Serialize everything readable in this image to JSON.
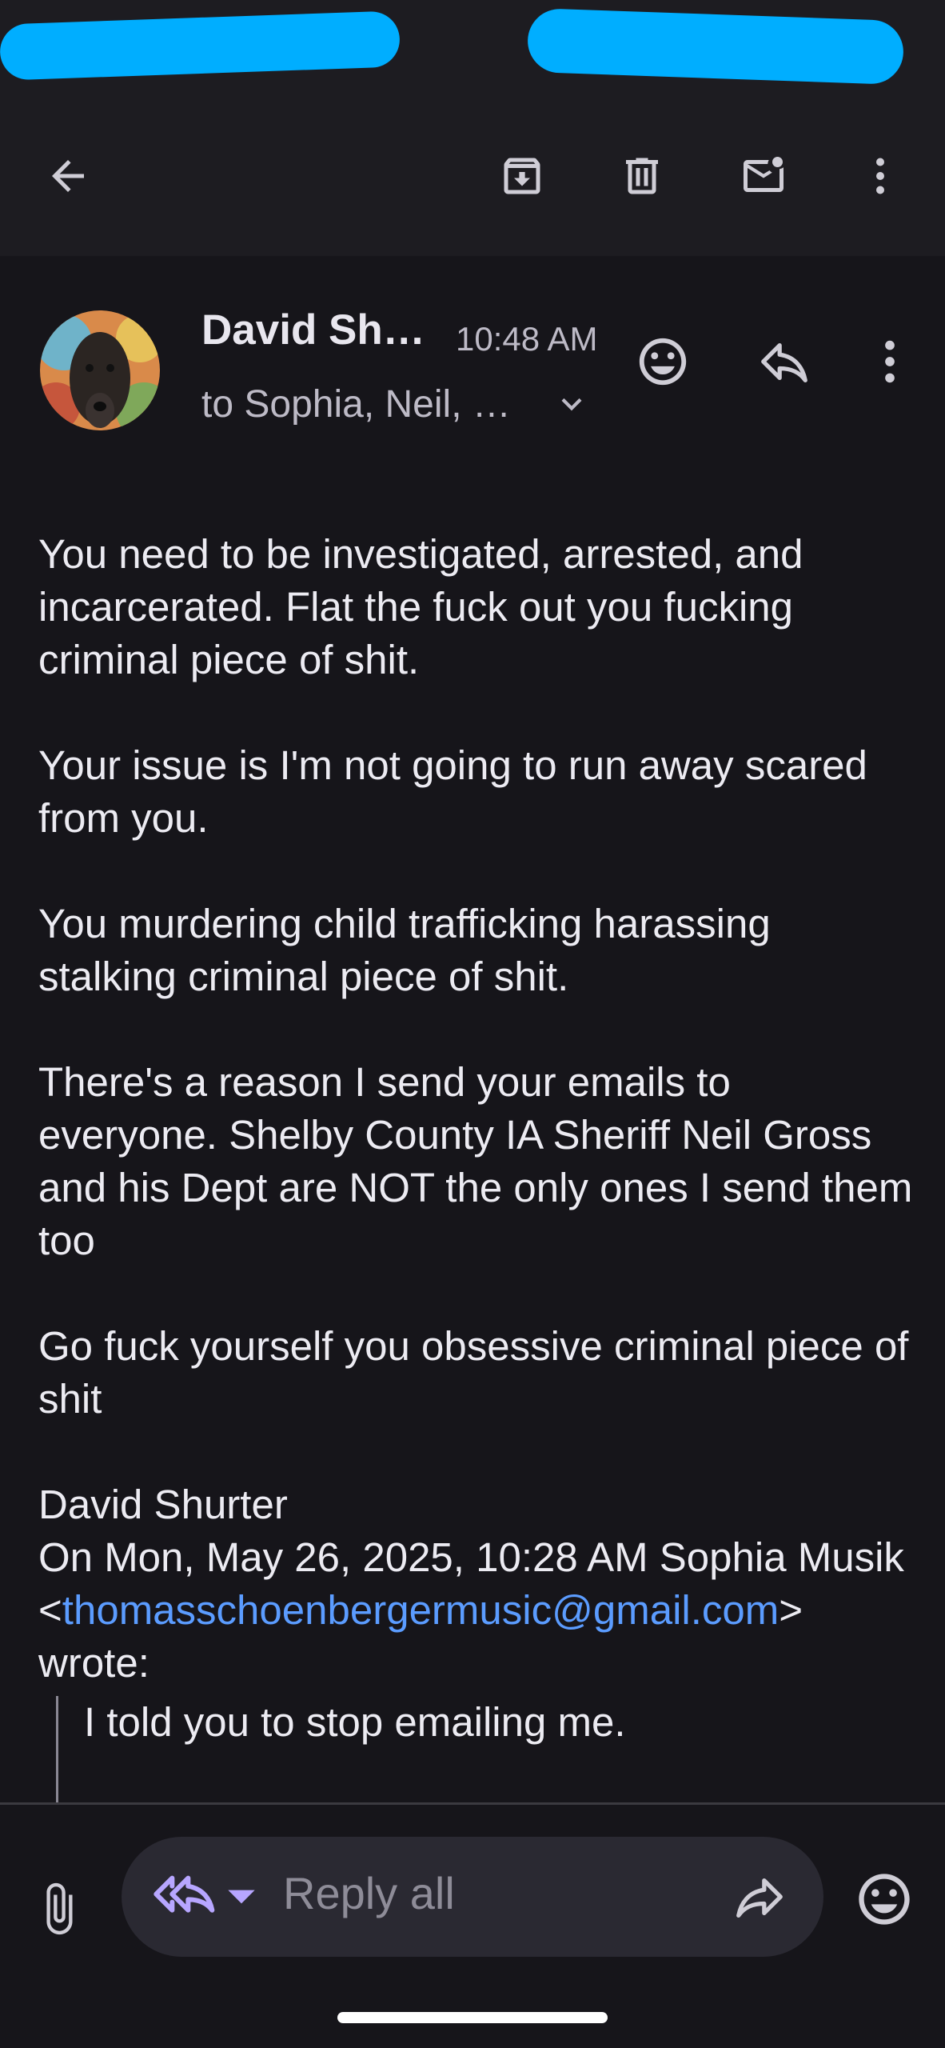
{
  "toolbar": {
    "back_icon": "arrow-left-icon",
    "archive_icon": "archive-icon",
    "delete_icon": "trash-icon",
    "mark_unread_icon": "mail-unread-icon",
    "more_icon": "more-vert-icon"
  },
  "message": {
    "sender": "David Sh…",
    "time": "10:48 AM",
    "recipients": "to Sophia, Neil, …",
    "paragraphs": [
      "You need to be investigated, arrested, and incarcerated. Flat the fuck out you fucking criminal piece of shit.",
      "Your issue is I'm not going to run away scared from you.",
      "You murdering child trafficking harassing stalking criminal piece of shit.",
      "There's a reason I send your emails to everyone. Shelby County IA Sheriff Neil Gross and his Dept are NOT the only ones I send them too",
      "Go fuck yourself you obsessive criminal piece of shit"
    ],
    "signature": "David Shurter",
    "quote_header_pre": "On Mon, May 26, 2025, 10:28 AM Sophia Musik <",
    "quote_email": "thomasschoenbergermusic@gmail.com",
    "quote_header_post": "> wrote:",
    "quoted_text": "I told you to stop emailing me."
  },
  "compose": {
    "placeholder": "Reply all"
  },
  "colors": {
    "background": "#16151a",
    "toolbar": "#1d1c21",
    "link": "#5b9cff",
    "reply_icon": "#b7a6ff"
  }
}
